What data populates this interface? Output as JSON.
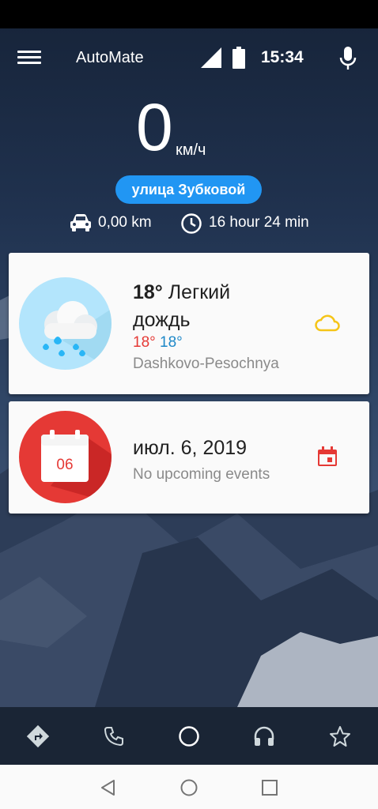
{
  "app": {
    "title": "AutoMate"
  },
  "status": {
    "time": "15:34"
  },
  "speed": {
    "value": "0",
    "unit": "км/ч"
  },
  "street": {
    "name": "улица Зубковой"
  },
  "trip": {
    "distance": "0,00 km",
    "duration": "16 hour 24 min"
  },
  "weather": {
    "temp": "18°",
    "condition": "Легкий дождь",
    "temp_high": "18°",
    "temp_low": "18°",
    "location": "Dashkovo-Pesochnya",
    "icon": "cloud-rain-icon",
    "accent": "#f5c518"
  },
  "calendar": {
    "day": "06",
    "date": "июл. 6, 2019",
    "events": "No upcoming events",
    "accent": "#e53935"
  },
  "bottom_nav": [
    {
      "icon": "directions-icon"
    },
    {
      "icon": "phone-icon"
    },
    {
      "icon": "home-circle-icon"
    },
    {
      "icon": "headphones-icon"
    },
    {
      "icon": "star-icon"
    }
  ],
  "system_nav": [
    {
      "icon": "back-icon"
    },
    {
      "icon": "home-icon"
    },
    {
      "icon": "recents-icon"
    }
  ]
}
